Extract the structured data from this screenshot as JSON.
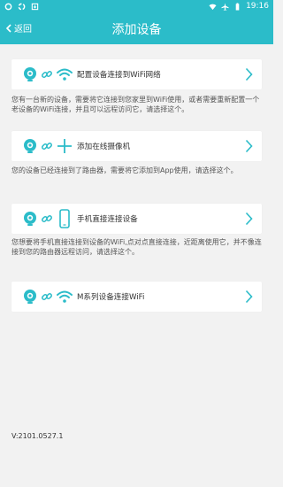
{
  "status": {
    "time": "19:16"
  },
  "nav": {
    "back_label": "返回",
    "title": "添加设备"
  },
  "options": [
    {
      "label": "配置设备连接到WiFi网络",
      "desc": "您有一台新的设备，需要将它连接到您家里到WiFi使用，或者需要重新配置一个老设备的WiFi连接，并且可以远程访问它，请选择这个。",
      "icon_kind": "wifi-icon"
    },
    {
      "label": "添加在线摄像机",
      "desc": "您的设备已经连接到了路由器，需要将它添加到App使用，请选择这个。",
      "icon_kind": "plus-icon"
    },
    {
      "label": "手机直接连接设备",
      "desc": "您想要将手机直接连接到设备的WiFi,点对点直接连接，近距离使用它，并不像连接到您的路由器远程访问，请选择这个。",
      "icon_kind": "phone-icon"
    },
    {
      "label": "M系列设备连接WiFi",
      "desc": "",
      "icon_kind": "wifi-icon"
    }
  ],
  "version": "V:2101.0527.1",
  "colors": {
    "accent": "#2bbcc9"
  }
}
